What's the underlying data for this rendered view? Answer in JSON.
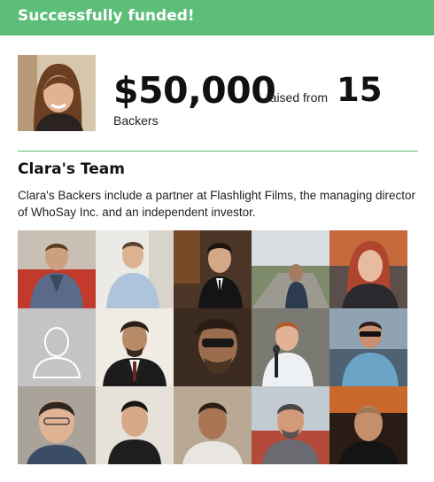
{
  "banner": {
    "text": "Successfully funded!",
    "color": "#5dbe78"
  },
  "funding": {
    "amount": "$50,000",
    "raised_from": "raised from",
    "backers_count": "15",
    "backers_label": "Backers"
  },
  "team": {
    "title": "Clara's Team",
    "description": "Clara's Backers include a partner at Flashlight Films, the managing director of WhoSay Inc. and an independent investor."
  },
  "backers": [
    {
      "photo": "backer-photo"
    },
    {
      "photo": "backer-photo"
    },
    {
      "photo": "backer-photo"
    },
    {
      "photo": "backer-photo"
    },
    {
      "photo": "backer-photo"
    },
    {
      "photo": "default-avatar-icon"
    },
    {
      "photo": "backer-photo"
    },
    {
      "photo": "backer-photo"
    },
    {
      "photo": "backer-photo"
    },
    {
      "photo": "backer-photo"
    },
    {
      "photo": "backer-photo"
    },
    {
      "photo": "backer-photo"
    },
    {
      "photo": "backer-photo"
    },
    {
      "photo": "backer-photo"
    },
    {
      "photo": "backer-photo"
    }
  ]
}
